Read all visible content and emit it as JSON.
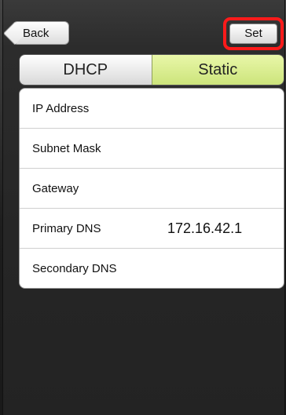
{
  "nav": {
    "back_label": "Back",
    "set_label": "Set"
  },
  "mode": {
    "options": [
      "DHCP",
      "Static"
    ],
    "selected": "Static"
  },
  "fields": [
    {
      "label": "IP Address",
      "value": ""
    },
    {
      "label": "Subnet Mask",
      "value": ""
    },
    {
      "label": "Gateway",
      "value": ""
    },
    {
      "label": "Primary DNS",
      "value": "172.16.42.1"
    },
    {
      "label": "Secondary DNS",
      "value": ""
    }
  ],
  "colors": {
    "highlight_outline": "#ff1a1a",
    "selected_segment": "#d6ec8a"
  }
}
